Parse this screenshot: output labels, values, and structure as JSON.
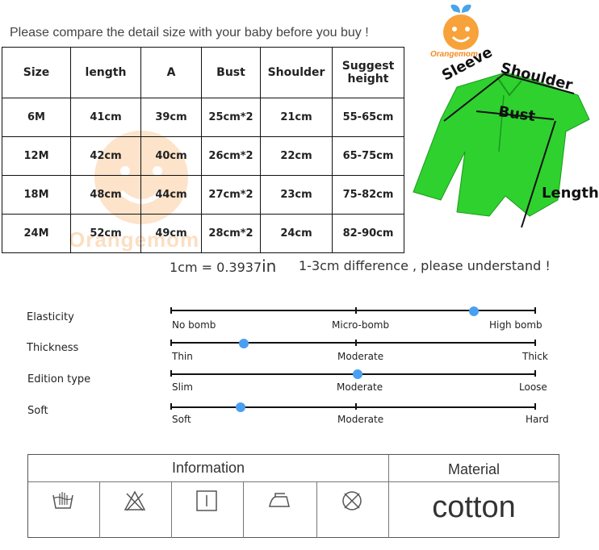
{
  "intro": "Please compare the detail size with your baby before you buy !",
  "size_table": {
    "headers": [
      "Size",
      "length",
      "A",
      "Bust",
      "Shoulder",
      "Suggest height"
    ],
    "rows": [
      [
        "6M",
        "41cm",
        "39cm",
        "25cm*2",
        "21cm",
        "55-65cm"
      ],
      [
        "12M",
        "42cm",
        "40cm",
        "26cm*2",
        "22cm",
        "65-75cm"
      ],
      [
        "18M",
        "48cm",
        "44cm",
        "27cm*2",
        "23cm",
        "75-82cm"
      ],
      [
        "24M",
        "52cm",
        "49cm",
        "28cm*2",
        "24cm",
        "82-90cm"
      ]
    ]
  },
  "watermark": "Orangemom",
  "logo": {
    "text": "Orangemom",
    "color": "#f5891e"
  },
  "diagram": {
    "sleeve": "Sleeve",
    "shoulder": "Shoulder",
    "bust": "Bust",
    "length": "Length",
    "garment_color": "#2fd12f"
  },
  "conversion": {
    "prefix": "1cm = 0.3937",
    "unit": "in"
  },
  "difference_note": "1-3cm difference , please understand !",
  "scales": [
    {
      "label": "Elasticity",
      "options": [
        "No bomb",
        "Micro-bomb",
        "High bomb"
      ],
      "level": 0.83
    },
    {
      "label": "Thickness",
      "options": [
        "Thin",
        "Moderate",
        "Thick"
      ],
      "level": 0.2
    },
    {
      "label": "Edition type",
      "options": [
        "Slim",
        "Moderate",
        "Loose"
      ],
      "level": 0.51
    },
    {
      "label": "Soft",
      "options": [
        "Soft",
        "Moderate",
        "Hard"
      ],
      "level": 0.19
    }
  ],
  "accent_color": "#4a9ff0",
  "care": {
    "info_title": "Information",
    "material_title": "Material",
    "material_value": "cotton",
    "icons": [
      "hand-wash-icon",
      "do-not-bleach-icon",
      "tumble-dry-icon",
      "iron-icon",
      "do-not-dry-clean-icon"
    ]
  }
}
